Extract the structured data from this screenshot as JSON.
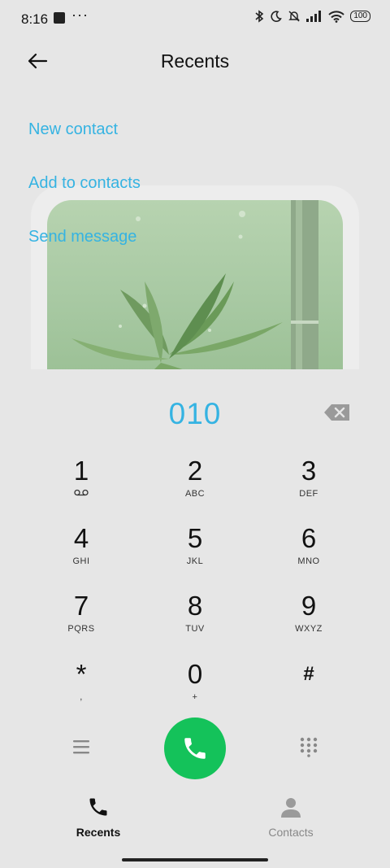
{
  "status_bar": {
    "time": "8:16",
    "dots": "···",
    "battery": "100"
  },
  "header": {
    "title": "Recents"
  },
  "actions": {
    "new_contact": "New contact",
    "add_to_contacts": "Add to contacts",
    "send_message": "Send message"
  },
  "dialer": {
    "number": "010"
  },
  "keypad": {
    "keys": [
      {
        "digit": "1",
        "letters": ""
      },
      {
        "digit": "2",
        "letters": "ABC"
      },
      {
        "digit": "3",
        "letters": "DEF"
      },
      {
        "digit": "4",
        "letters": "GHI"
      },
      {
        "digit": "5",
        "letters": "JKL"
      },
      {
        "digit": "6",
        "letters": "MNO"
      },
      {
        "digit": "7",
        "letters": "PQRS"
      },
      {
        "digit": "8",
        "letters": "TUV"
      },
      {
        "digit": "9",
        "letters": "WXYZ"
      },
      {
        "digit": "*",
        "letters": ","
      },
      {
        "digit": "0",
        "letters": "+"
      },
      {
        "digit": "#",
        "letters": ""
      }
    ]
  },
  "bottom_nav": {
    "recents": "Recents",
    "contacts": "Contacts"
  },
  "colors": {
    "accent": "#35b3e2",
    "call_green": "#14c25a",
    "background": "#e6e6e6"
  }
}
